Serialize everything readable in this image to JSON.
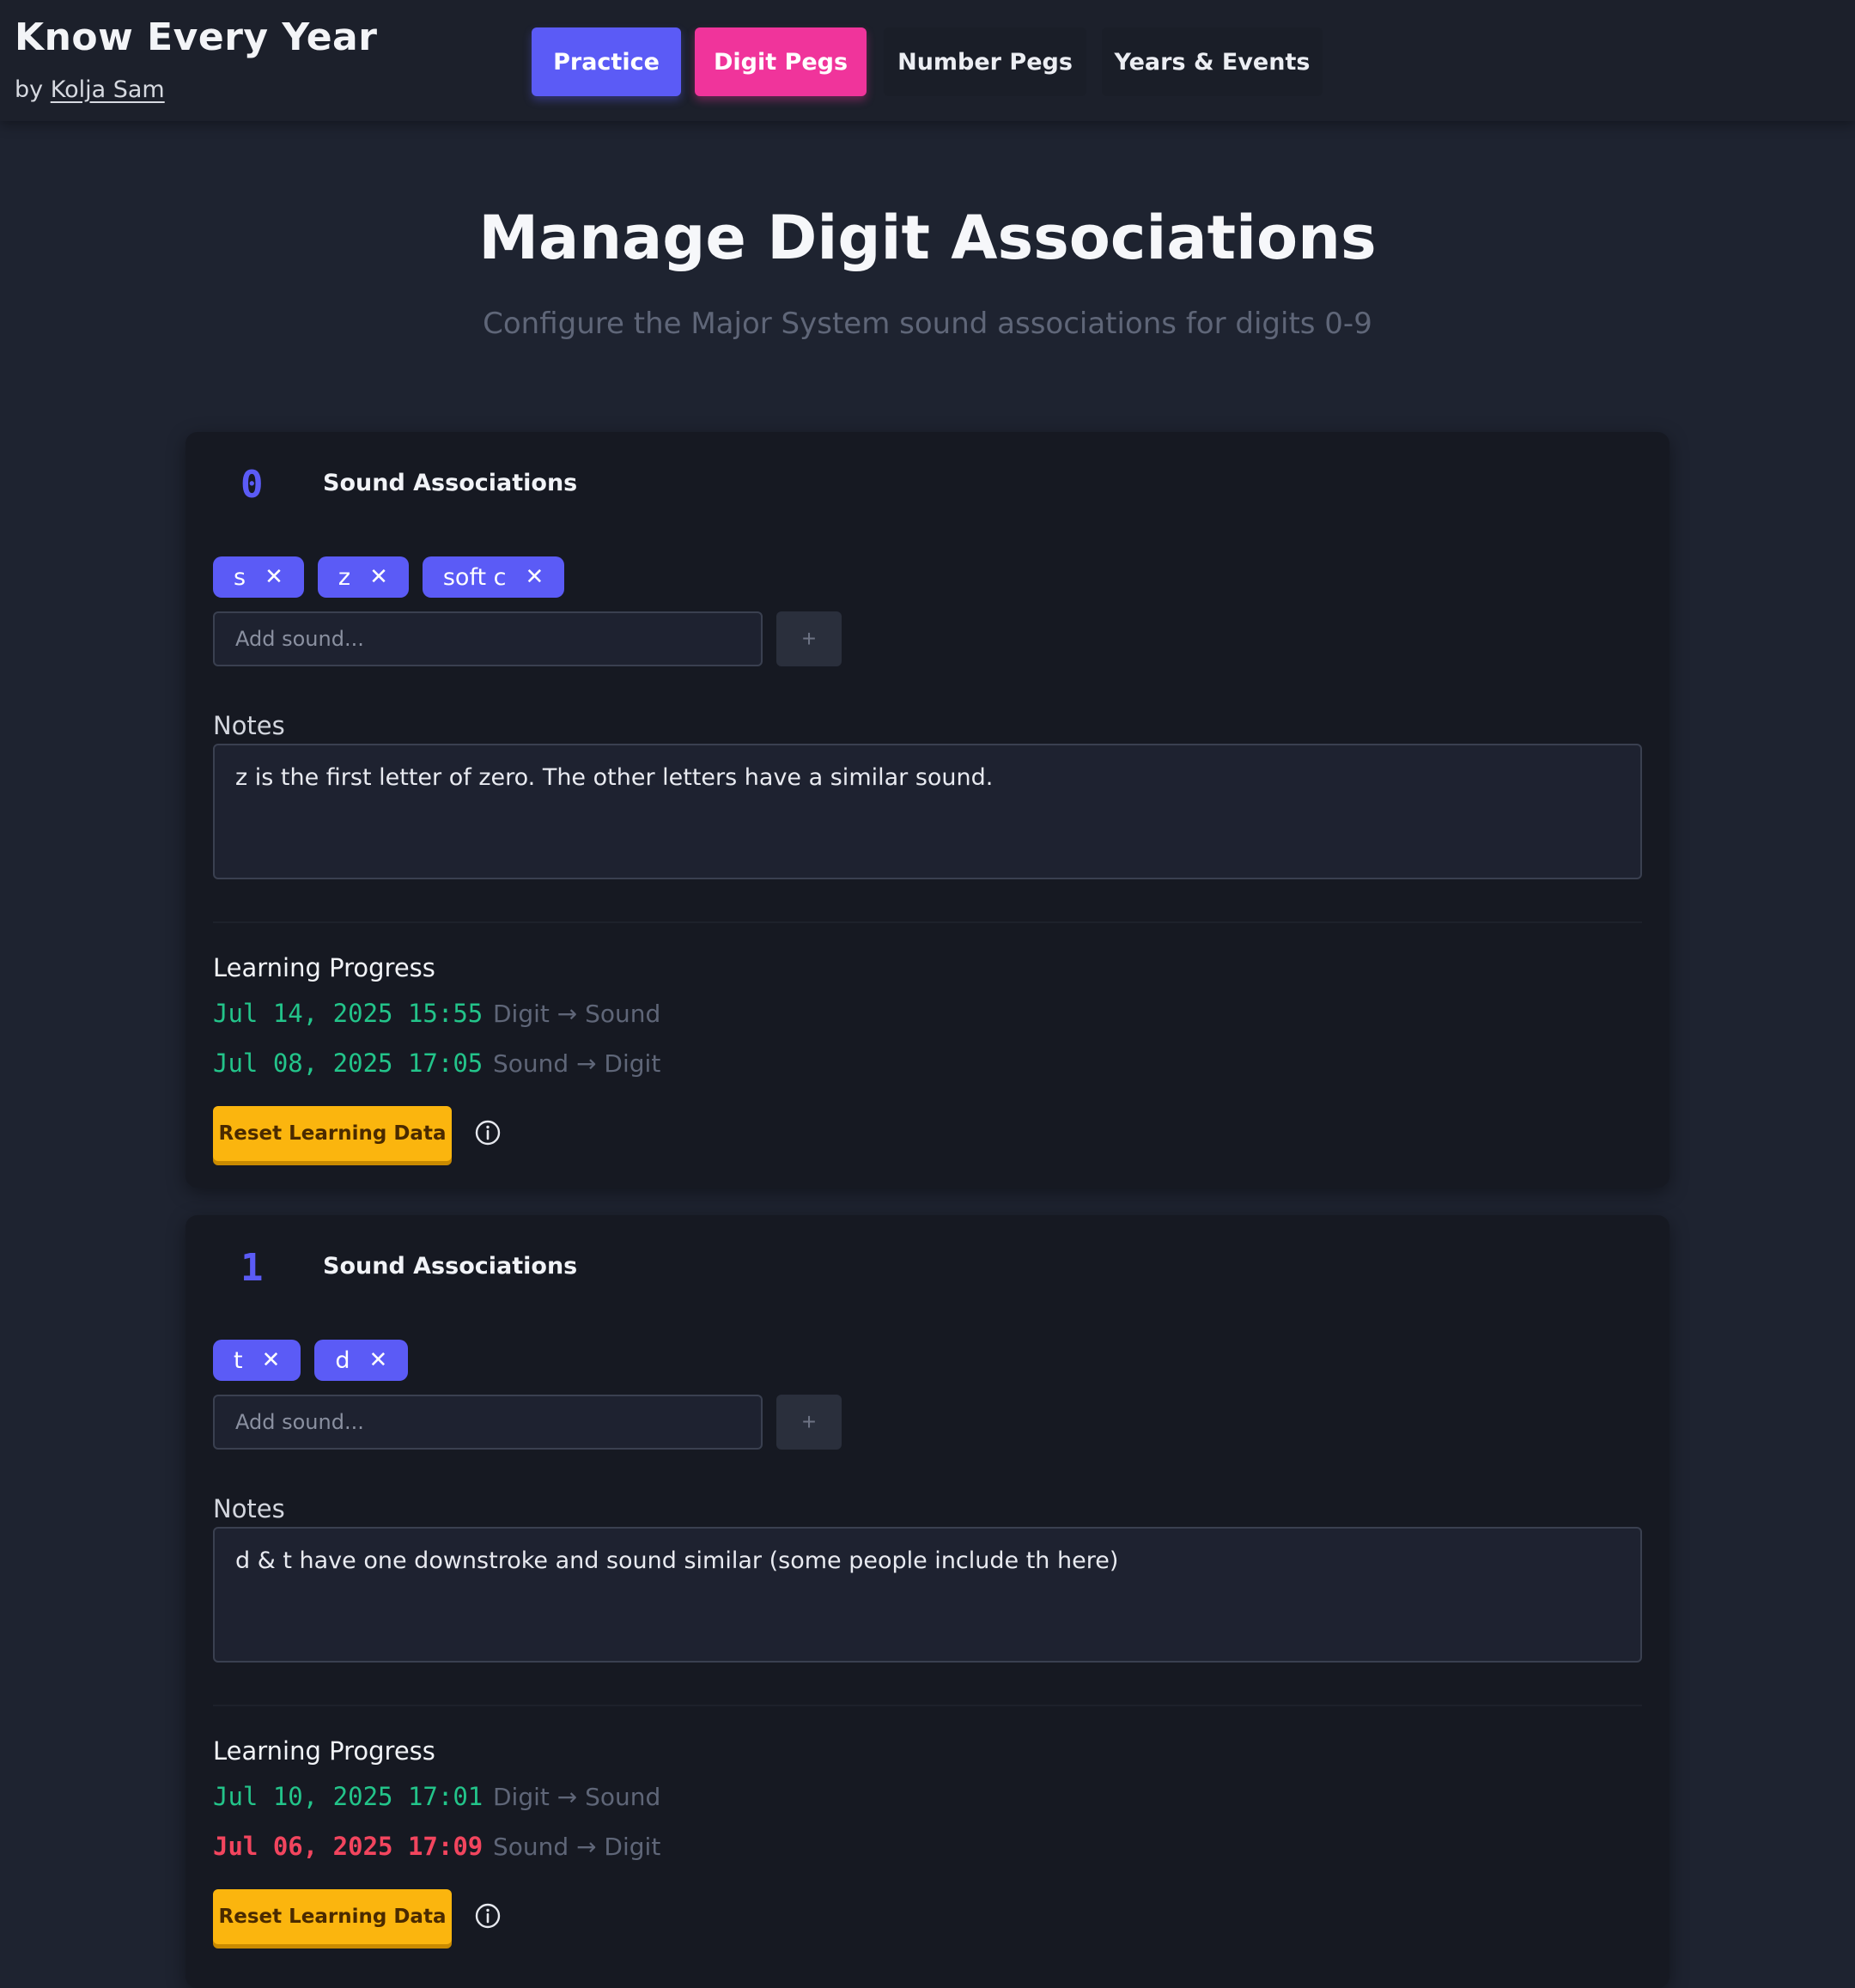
{
  "header": {
    "title": "Know Every Year",
    "by_prefix": "by",
    "author": "Kolja Sam",
    "nav": [
      {
        "label": "Practice",
        "color": "#5b5bf6"
      },
      {
        "label": "Digit Pegs",
        "color": "#f0349b",
        "active": true
      },
      {
        "label": "Number Pegs"
      },
      {
        "label": "Years & Events"
      }
    ]
  },
  "page": {
    "title": "Manage Digit Associations",
    "subtitle": "Configure the Major System sound associations for digits 0-9"
  },
  "colors": {
    "accent": "#5b5bf6",
    "active_tab": "#f0349b",
    "good": "#23c48a",
    "overdue": "#f2455e",
    "warning_button": "#fbb50e"
  },
  "cards": [
    {
      "digit": "0",
      "assoc_label": "Sound Associations",
      "tags": [
        "s",
        "z",
        "soft c"
      ],
      "remove_glyph": "✕",
      "add_placeholder": "Add sound...",
      "add_glyph": "+",
      "notes_label": "Notes",
      "notes": "z is the first letter of zero. The other letters have a similar sound.",
      "progress_label": "Learning Progress",
      "progress": [
        {
          "date": "Jul 14, 2025 15:55",
          "direction": "Digit → Sound",
          "status": "good"
        },
        {
          "date": "Jul 08, 2025 17:05",
          "direction": "Sound → Digit",
          "status": "good"
        }
      ],
      "reset_label": "Reset Learning Data",
      "info_icon": "info-circle-icon"
    },
    {
      "digit": "1",
      "assoc_label": "Sound Associations",
      "tags": [
        "t",
        "d"
      ],
      "remove_glyph": "✕",
      "add_placeholder": "Add sound...",
      "add_glyph": "+",
      "notes_label": "Notes",
      "notes": "d & t have one downstroke and sound similar (some people include th here)",
      "progress_label": "Learning Progress",
      "progress": [
        {
          "date": "Jul 10, 2025 17:01",
          "direction": "Digit → Sound",
          "status": "good"
        },
        {
          "date": "Jul 06, 2025 17:09",
          "direction": "Sound → Digit",
          "status": "overdue"
        }
      ],
      "reset_label": "Reset Learning Data",
      "info_icon": "info-circle-icon"
    }
  ]
}
